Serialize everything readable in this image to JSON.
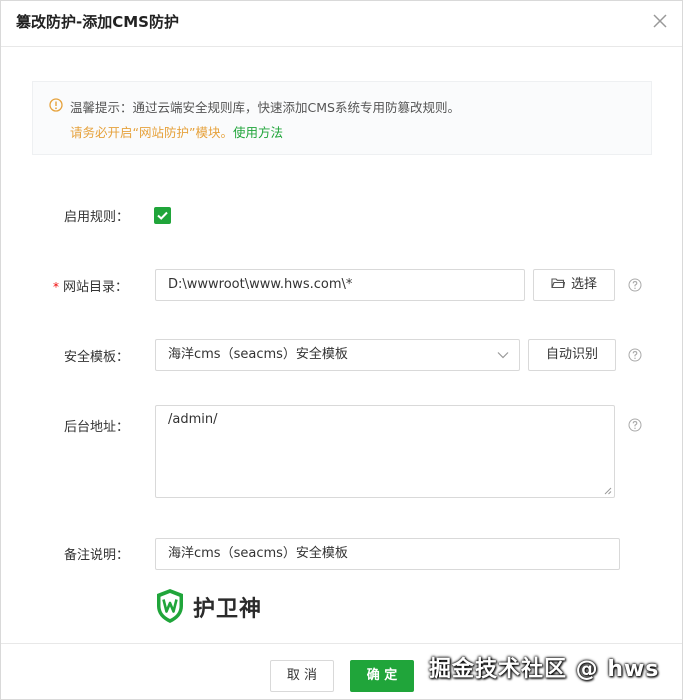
{
  "dialog": {
    "title": "篡改防护-添加CMS防护"
  },
  "notice": {
    "line1": "温馨提示：通过云端安全规则库，快速添加CMS系统专用防篡改规则。",
    "line2_prefix": "请务必开启“网站防护”模块。",
    "line2_link": "使用方法"
  },
  "form": {
    "enable_rule_label": "启用规则：",
    "enable_rule_checked": true,
    "site_dir_required_mark": "*",
    "site_dir_label": "网站目录：",
    "site_dir_value": "D:\\wwwroot\\www.hws.com\\*",
    "select_button_label": "选择",
    "template_label": "安全模板：",
    "template_value": "海洋cms（seacms）安全模板",
    "auto_detect_label": "自动识别",
    "backend_label": "后台地址：",
    "backend_value": "/admin/",
    "remark_label": "备注说明：",
    "remark_value": "海洋cms（seacms）安全模板"
  },
  "logo": {
    "text": "护卫神"
  },
  "footer": {
    "cancel_label": "取 消",
    "ok_label": "确 定"
  },
  "watermark": "掘金技术社区 @ hws",
  "colors": {
    "accent": "#20a53a",
    "warning": "#e6a23c",
    "required": "#ef0808"
  },
  "icons": [
    "close-icon",
    "info-icon",
    "check-icon",
    "folder-icon",
    "help-icon",
    "chevron-down-icon",
    "shield-logo-icon"
  ]
}
